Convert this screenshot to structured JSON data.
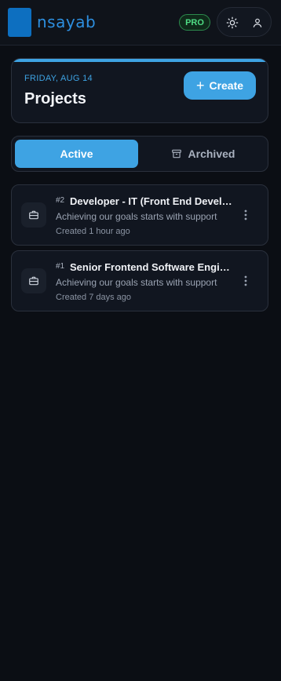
{
  "header": {
    "logo_text": "nsayab",
    "plan_badge": "PRO",
    "theme_icon": "sun-icon",
    "user_icon": "user-icon"
  },
  "top_card": {
    "date": "FRIDAY, AUG 14",
    "title": "Projects",
    "create_label": "Create",
    "create_icon": "plus-icon"
  },
  "tabs": [
    {
      "label": "Active",
      "selected": true
    },
    {
      "label": "Archived",
      "selected": false,
      "icon": "archive-icon"
    }
  ],
  "projects": [
    {
      "number": "#2",
      "title": "Developer - IT (Front End Developer)",
      "description": "Achieving our goals starts with support",
      "created": "Created 1 hour ago",
      "icon": "briefcase-icon"
    },
    {
      "number": "#1",
      "title": "Senior Frontend Software Engineer",
      "description": "Achieving our goals starts with support",
      "created": "Created 7 days ago",
      "icon": "briefcase-icon"
    }
  ],
  "colors": {
    "accent": "#3ea3e3",
    "background": "#0b0e14",
    "card": "#111620",
    "pro_green": "#4fdc85"
  }
}
